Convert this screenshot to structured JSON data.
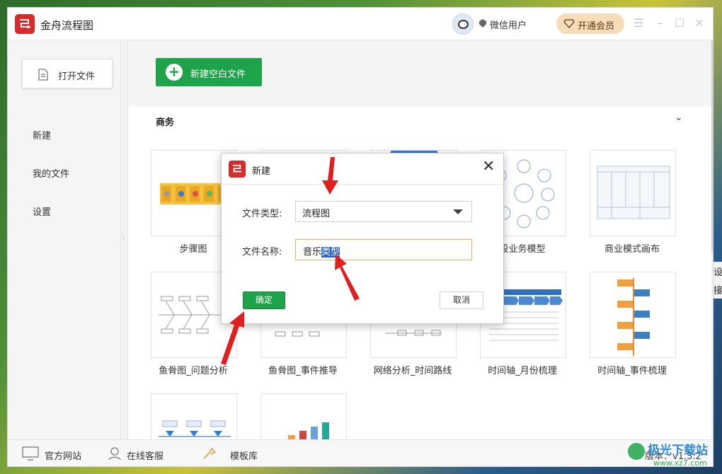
{
  "app": {
    "title": "金舟流程图",
    "user_name": "微信用户",
    "vip_label": "开通会员",
    "colors": {
      "brand": "#d92b2b",
      "accent": "#1fa34a",
      "vip_bg": "#f6dcb8"
    },
    "icons": [
      "app-logo-icon",
      "user-avatar",
      "user-badge-icon",
      "diamond-icon",
      "menu-icon",
      "minimize-icon",
      "maximize-icon",
      "close-icon"
    ]
  },
  "sidebar": {
    "open_file": "打开文件",
    "items": [
      {
        "label": "新建"
      },
      {
        "label": "我的文件"
      },
      {
        "label": "设置"
      }
    ]
  },
  "main": {
    "new_blank": "新建空白文件",
    "section": "商务",
    "templates": [
      {
        "label": "步骤图"
      },
      {
        "label": ""
      },
      {
        "label": ""
      },
      {
        "label": "段业务模型"
      },
      {
        "label": "商业模式画布"
      },
      {
        "label": "鱼骨图_问题分析"
      },
      {
        "label": "鱼骨图_事件推导"
      },
      {
        "label": "网络分析_时间路线"
      },
      {
        "label": "时间轴_月份梳理"
      },
      {
        "label": "时间轴_事件梳理"
      },
      {
        "label": ""
      },
      {
        "label": ""
      }
    ]
  },
  "bottombar": {
    "website": "官方网站",
    "support": "在线客服",
    "templates": "模板库",
    "version": "版本：v1.3.2"
  },
  "dialog": {
    "title": "新建",
    "file_type_label": "文件类型:",
    "file_type_value": "流程图",
    "file_name_label": "文件名称:",
    "file_name_prefix": "音乐",
    "file_name_selected": "类型",
    "ok": "确定",
    "cancel": "取消"
  },
  "peek": {
    "line1": "设",
    "line2": "接"
  },
  "watermark": {
    "text": "极光下载站",
    "url": "www.xz7.com"
  }
}
